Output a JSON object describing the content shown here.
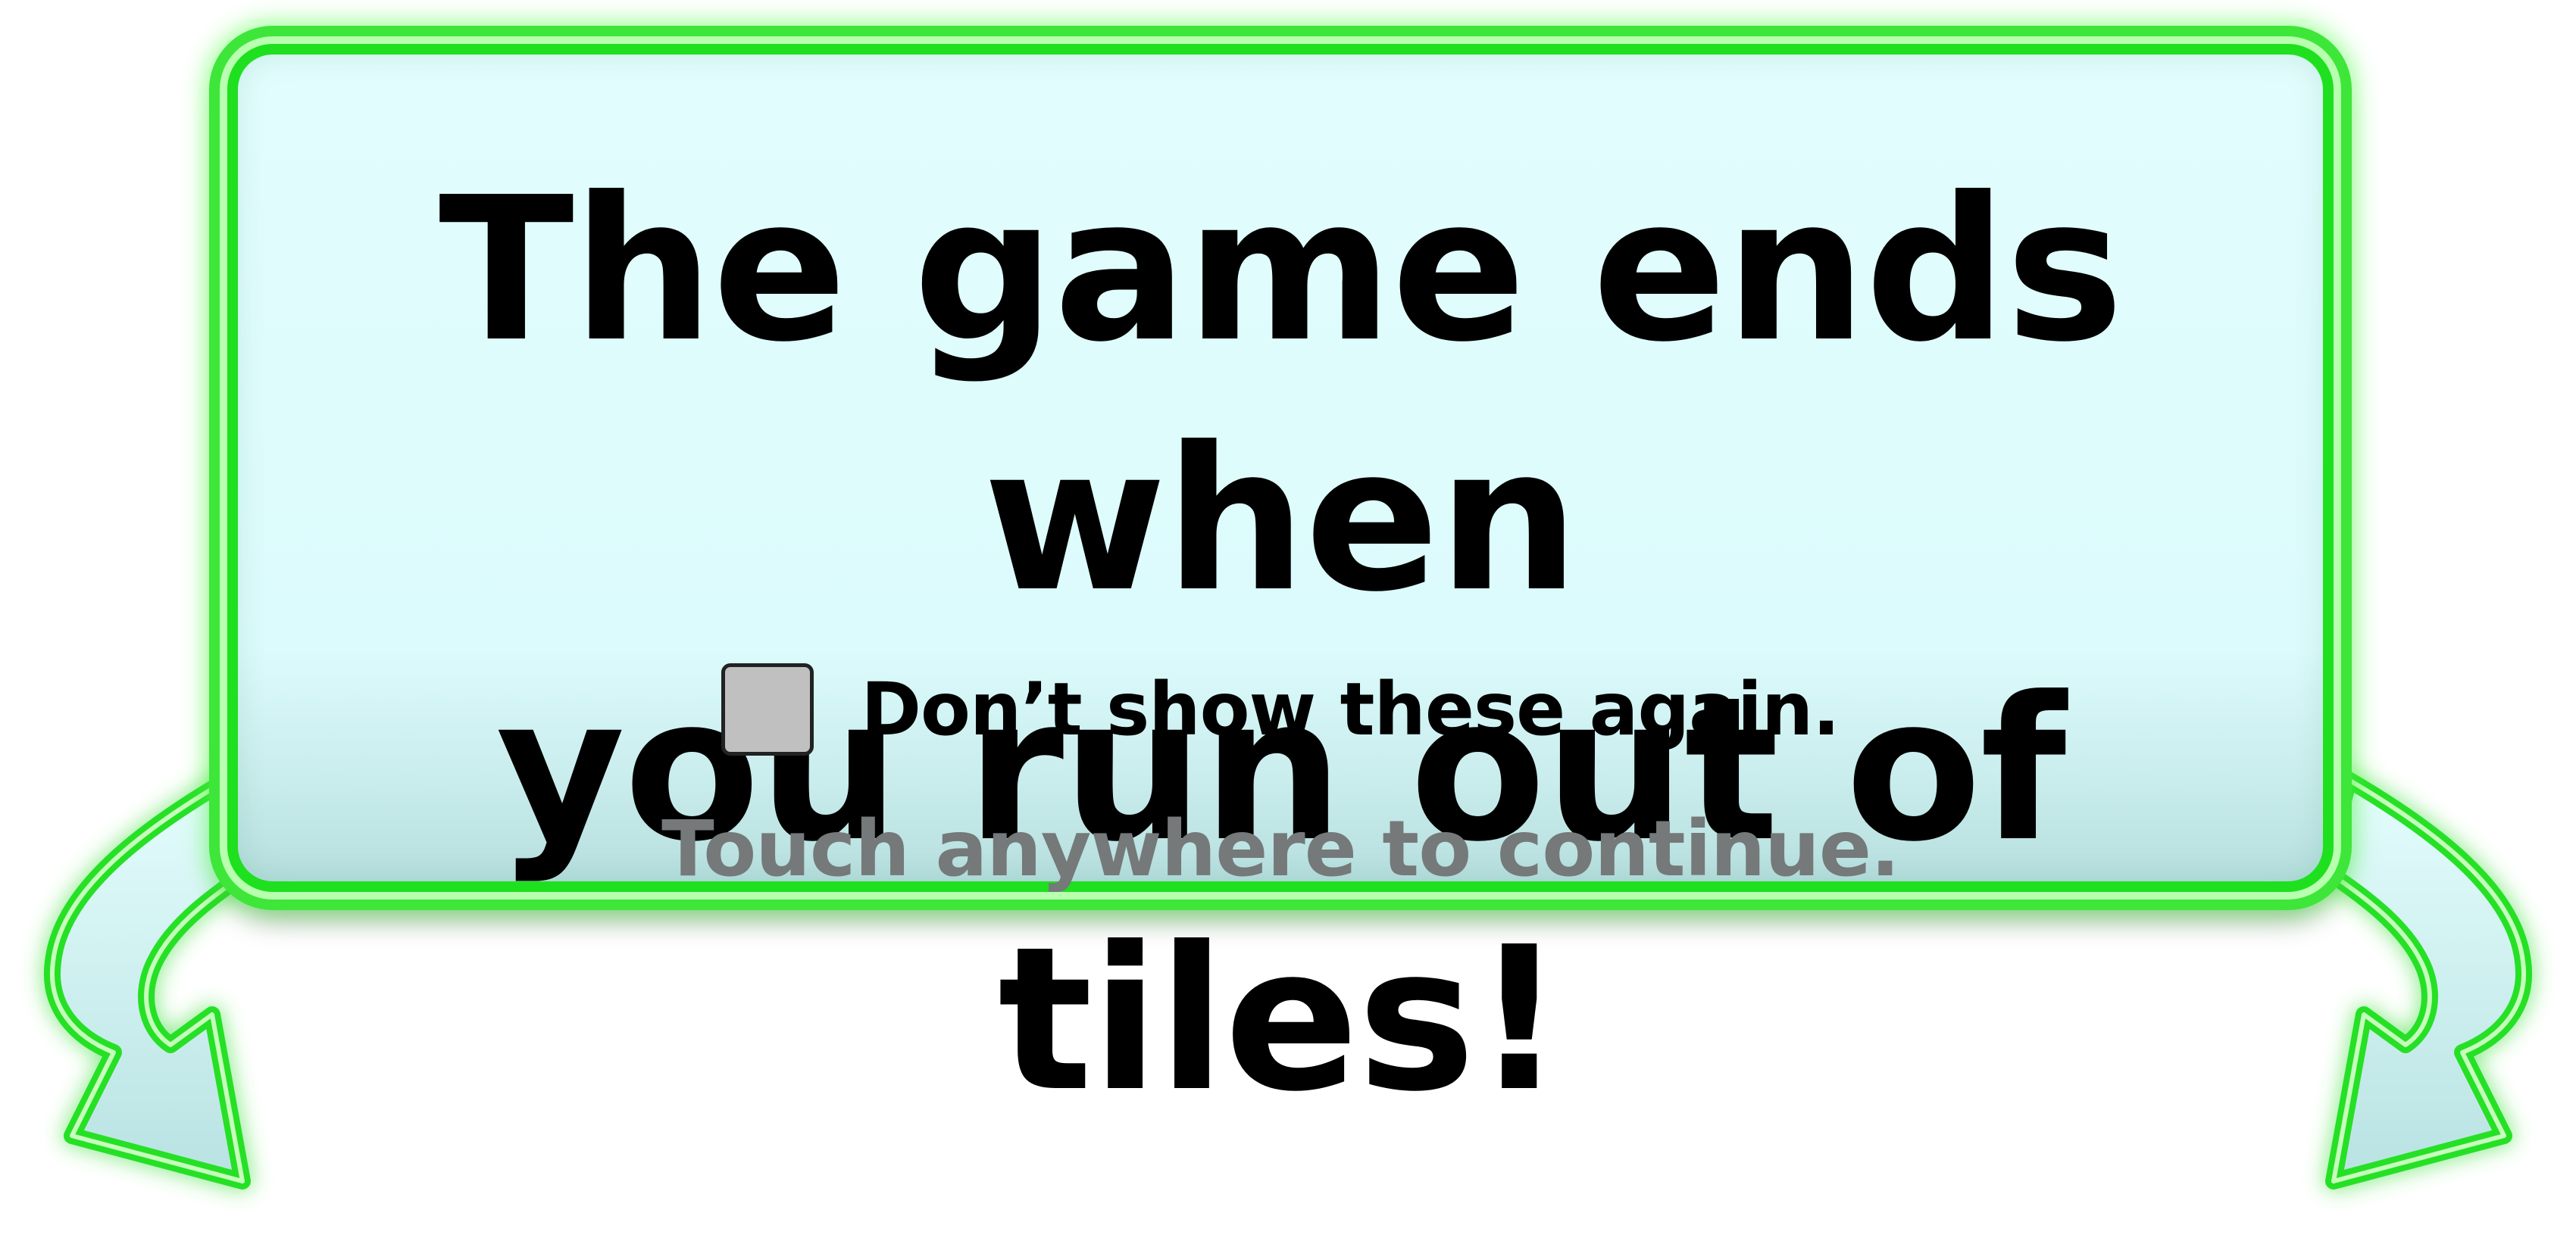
{
  "dialog": {
    "headline_line1": "The game ends when",
    "headline_line2": "you run out of tiles!",
    "checkbox_label": "Don’t show these again.",
    "checkbox_checked": false,
    "continue_hint": "Touch anywhere to continue."
  },
  "colors": {
    "neon_border": "#1fe01f",
    "neon_glow": "#50ff46",
    "panel_fill": "#dcfbfc",
    "headline_text": "#000000",
    "hint_text": "#757979",
    "checkbox_fill": "#c0c0c0"
  },
  "icons": {
    "left_arrow": "curved-down-arrow-left-icon",
    "right_arrow": "curved-down-arrow-right-icon"
  }
}
